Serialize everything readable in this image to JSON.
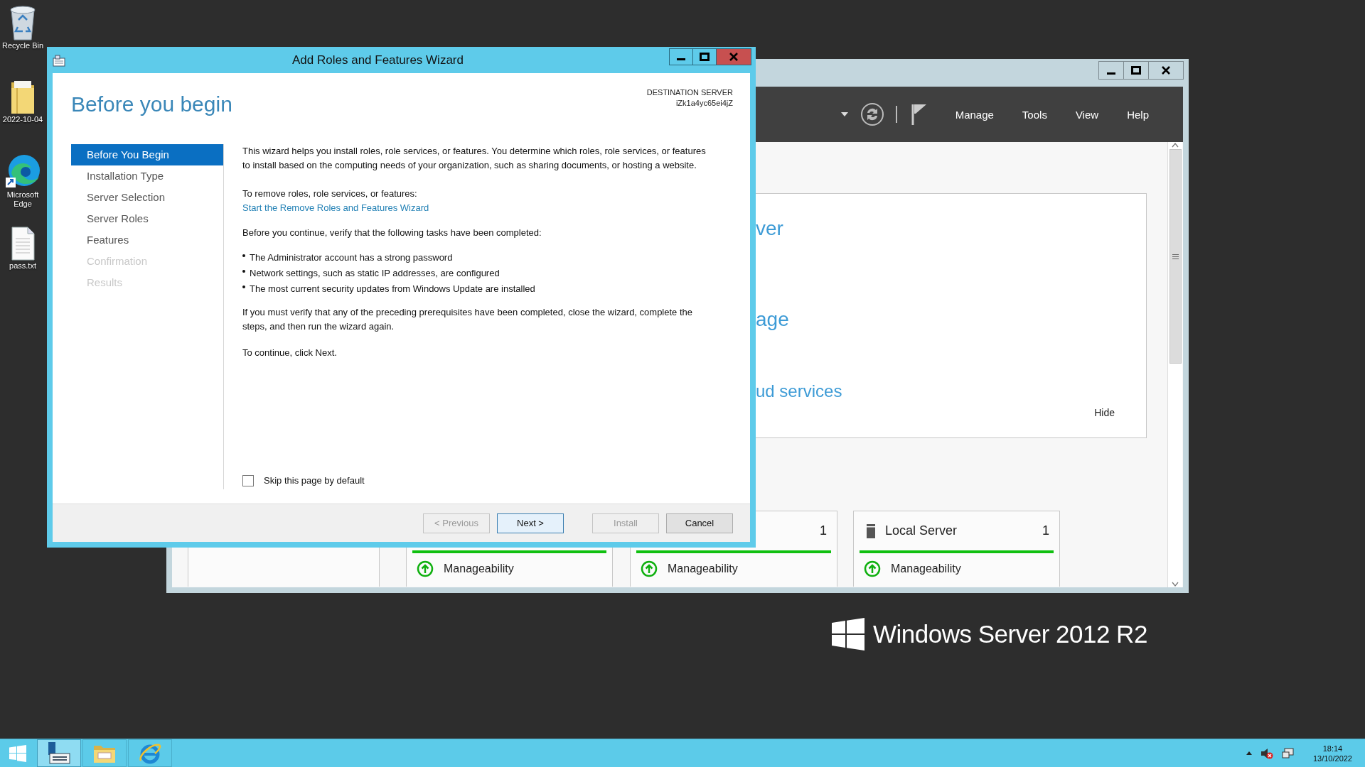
{
  "desktop": {
    "icons": [
      {
        "kind": "recycle-bin",
        "label": "Recycle Bin"
      },
      {
        "kind": "folder",
        "label": "2022-10-04"
      },
      {
        "kind": "edge",
        "label": "Microsoft Edge"
      },
      {
        "kind": "text-file",
        "label": "pass.txt"
      }
    ]
  },
  "server_manager": {
    "menu": [
      "Manage",
      "Tools",
      "View",
      "Help"
    ],
    "welcome": {
      "fragments": [
        "ver",
        "age",
        "ud services"
      ],
      "hide": "Hide"
    },
    "tiles": [
      {
        "kind": "blank"
      },
      {
        "kind": "server-group",
        "status": "Manageability"
      },
      {
        "kind": "server-group",
        "count": "1",
        "status": "Manageability"
      },
      {
        "kind": "server-group",
        "title": "Local Server",
        "count": "1",
        "status": "Manageability"
      }
    ]
  },
  "wizard": {
    "title": "Add Roles and Features Wizard",
    "heading": "Before you begin",
    "destination_label": "DESTINATION SERVER",
    "destination_server": "iZk1a4yc65ei4jZ",
    "steps": [
      {
        "label": "Before You Begin",
        "selected": true,
        "disabled": false
      },
      {
        "label": "Installation Type",
        "selected": false,
        "disabled": false
      },
      {
        "label": "Server Selection",
        "selected": false,
        "disabled": false
      },
      {
        "label": "Server Roles",
        "selected": false,
        "disabled": false
      },
      {
        "label": "Features",
        "selected": false,
        "disabled": false
      },
      {
        "label": "Confirmation",
        "selected": false,
        "disabled": true
      },
      {
        "label": "Results",
        "selected": false,
        "disabled": true
      }
    ],
    "intro": "This wizard helps you install roles, role services, or features. You determine which roles, role services, or features to install based on the computing needs of your organization, such as sharing documents, or hosting a website.",
    "remove_label": "To remove roles, role services, or features:",
    "remove_link": "Start the Remove Roles and Features Wizard",
    "verify_intro": "Before you continue, verify that the following tasks have been completed:",
    "tasks": [
      "The Administrator account has a strong password",
      "Network settings, such as static IP addresses, are configured",
      "The most current security updates from Windows Update are installed"
    ],
    "prereq_note": "If you must verify that any of the preceding prerequisites have been completed, close the wizard, complete the steps, and then run the wizard again.",
    "continue_note": "To continue, click Next.",
    "skip_checkbox": {
      "label": "Skip this page by default",
      "checked": false
    },
    "buttons": [
      {
        "label": "< Previous",
        "disabled": true,
        "default": false
      },
      {
        "label": "Next >",
        "disabled": false,
        "default": true
      },
      {
        "label": "Install",
        "disabled": true,
        "default": false
      },
      {
        "label": "Cancel",
        "disabled": false,
        "default": false
      }
    ]
  },
  "branding": "Windows Server 2012 R2",
  "taskbar": {
    "apps": [
      {
        "kind": "server-manager",
        "selected": true
      },
      {
        "kind": "file-explorer",
        "selected": false
      },
      {
        "kind": "internet-explorer",
        "selected": false
      }
    ],
    "time": "18:14",
    "date": "13/10/2022"
  }
}
